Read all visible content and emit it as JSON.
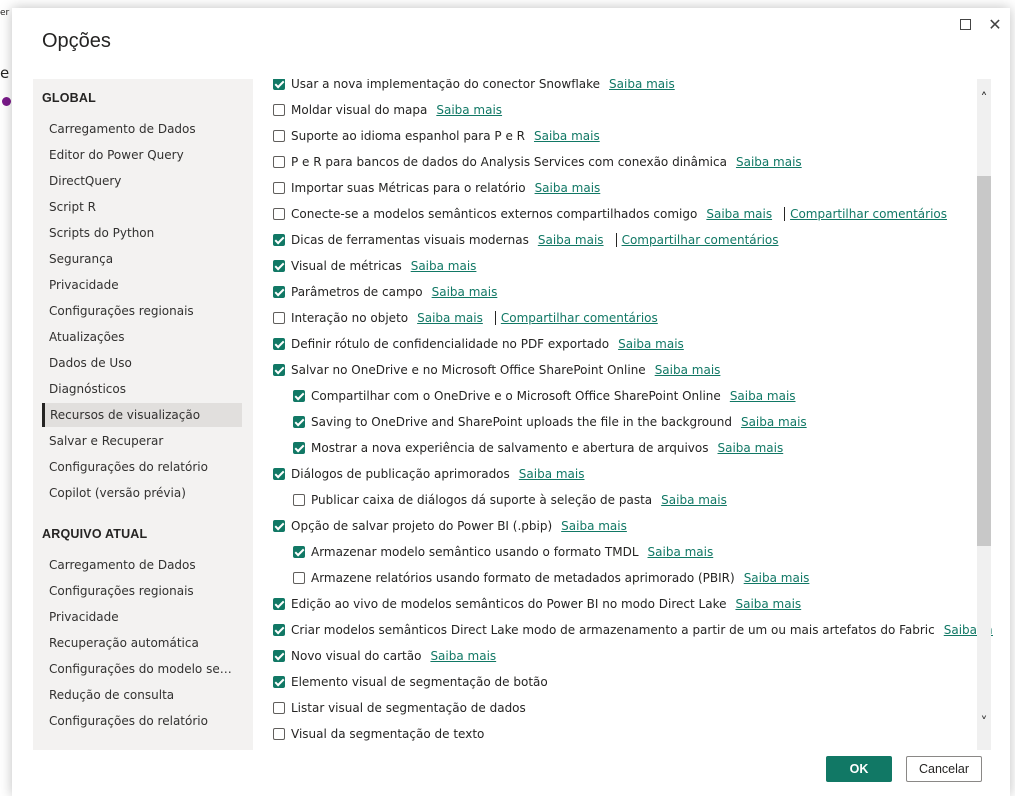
{
  "dialog": {
    "title": "Opções",
    "ok_label": "OK",
    "cancel_label": "Cancelar"
  },
  "background": {
    "left_fragments": [
      "er",
      "e"
    ]
  },
  "sidebar": {
    "global_heading": "GLOBAL",
    "global_items": [
      "Carregamento de Dados",
      "Editor do Power Query",
      "DirectQuery",
      "Script R",
      "Scripts do Python",
      "Segurança",
      "Privacidade",
      "Configurações regionais",
      "Atualizações",
      "Dados de Uso",
      "Diagnósticos",
      "Recursos de visualização",
      "Salvar e Recuperar",
      "Configurações do relatório",
      "Copilot (versão prévia)"
    ],
    "selected_item": "Recursos de visualização",
    "current_heading": "ARQUIVO ATUAL",
    "current_items": [
      "Carregamento de Dados",
      "Configurações regionais",
      "Privacidade",
      "Recuperação automática",
      "Configurações do modelo semân...",
      "Redução de consulta",
      "Configurações do relatório"
    ]
  },
  "features": [
    {
      "label": "Usar a nova implementação do conector Snowflake",
      "checked": true,
      "indent": false,
      "link": "Saiba mais",
      "feedback": ""
    },
    {
      "label": "Moldar visual do mapa",
      "checked": false,
      "indent": false,
      "link": "Saiba mais",
      "feedback": ""
    },
    {
      "label": "Suporte ao idioma espanhol para P e R",
      "checked": false,
      "indent": false,
      "link": "Saiba mais",
      "feedback": ""
    },
    {
      "label": "P e R para bancos de dados do Analysis Services com conexão dinâmica",
      "checked": false,
      "indent": false,
      "link": "Saiba mais",
      "feedback": ""
    },
    {
      "label": "Importar suas Métricas para o relatório",
      "checked": false,
      "indent": false,
      "link": "Saiba mais",
      "feedback": ""
    },
    {
      "label": "Conecte-se a modelos semânticos externos compartilhados comigo",
      "checked": false,
      "indent": false,
      "link": "Saiba mais",
      "feedback": "Compartilhar comentários"
    },
    {
      "label": "Dicas de ferramentas visuais modernas",
      "checked": true,
      "indent": false,
      "link": "Saiba mais",
      "feedback": "Compartilhar comentários"
    },
    {
      "label": "Visual de métricas",
      "checked": true,
      "indent": false,
      "link": "Saiba mais",
      "feedback": ""
    },
    {
      "label": "Parâmetros de campo",
      "checked": true,
      "indent": false,
      "link": "Saiba mais",
      "feedback": ""
    },
    {
      "label": "Interação no objeto",
      "checked": false,
      "indent": false,
      "link": "Saiba mais",
      "feedback": "Compartilhar comentários"
    },
    {
      "label": "Definir rótulo de confidencialidade no PDF exportado",
      "checked": true,
      "indent": false,
      "link": "Saiba mais",
      "feedback": ""
    },
    {
      "label": "Salvar no OneDrive e no Microsoft Office SharePoint Online",
      "checked": true,
      "indent": false,
      "link": "Saiba mais",
      "feedback": ""
    },
    {
      "label": "Compartilhar com o OneDrive e o Microsoft Office SharePoint Online",
      "checked": true,
      "indent": true,
      "link": "Saiba mais",
      "feedback": ""
    },
    {
      "label": "Saving to OneDrive and SharePoint uploads the file in the background",
      "checked": true,
      "indent": true,
      "link": "Saiba mais",
      "feedback": ""
    },
    {
      "label": "Mostrar a nova experiência de salvamento e abertura de arquivos",
      "checked": true,
      "indent": true,
      "link": "Saiba mais",
      "feedback": ""
    },
    {
      "label": "Diálogos de publicação aprimorados",
      "checked": true,
      "indent": false,
      "link": "Saiba mais",
      "feedback": ""
    },
    {
      "label": "Publicar caixa de diálogos dá suporte à seleção de pasta",
      "checked": false,
      "indent": true,
      "link": "Saiba mais",
      "feedback": ""
    },
    {
      "label": "Opção de salvar projeto do Power BI (.pbip)",
      "checked": true,
      "indent": false,
      "link": "Saiba mais",
      "feedback": ""
    },
    {
      "label": "Armazenar modelo semântico usando o formato TMDL",
      "checked": true,
      "indent": true,
      "link": "Saiba mais",
      "feedback": ""
    },
    {
      "label": "Armazene relatórios usando formato de metadados aprimorado (PBIR)",
      "checked": false,
      "indent": true,
      "link": "Saiba mais",
      "feedback": ""
    },
    {
      "label": "Edição ao vivo de modelos semânticos do Power BI no modo Direct Lake",
      "checked": true,
      "indent": false,
      "link": "Saiba mais",
      "feedback": ""
    },
    {
      "label": "Criar modelos semânticos Direct Lake modo de armazenamento a partir de um ou mais artefatos do Fabric",
      "checked": true,
      "indent": false,
      "link": "Saiba mais",
      "feedback": ""
    },
    {
      "label": "Novo visual do cartão",
      "checked": true,
      "indent": false,
      "link": "Saiba mais",
      "feedback": ""
    },
    {
      "label": "Elemento visual de segmentação de botão",
      "checked": true,
      "indent": false,
      "link": "",
      "feedback": ""
    },
    {
      "label": "Listar visual de segmentação de dados",
      "checked": false,
      "indent": false,
      "link": "",
      "feedback": ""
    },
    {
      "label": "Visual da segmentação de texto",
      "checked": false,
      "indent": false,
      "link": "",
      "feedback": ""
    }
  ],
  "colors": {
    "accent": "#117865",
    "sidebar_bg": "#f3f2f1",
    "selected_bg": "#e1dfdd"
  }
}
